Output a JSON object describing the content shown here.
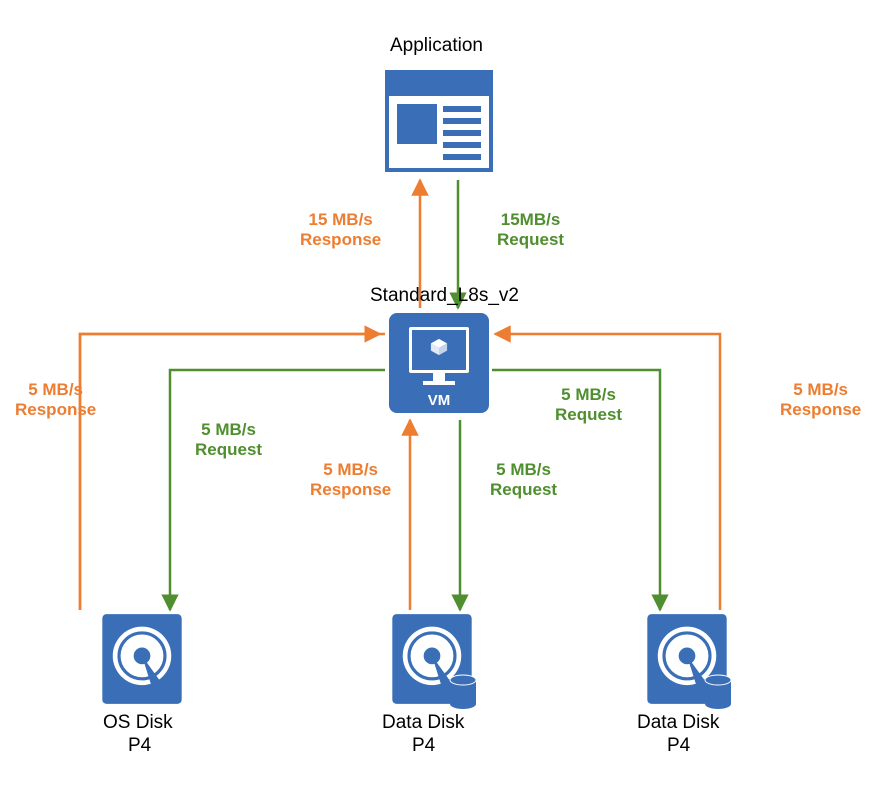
{
  "colors": {
    "blue": "#3a6fb7",
    "orange": "#ed7d31",
    "green": "#4f8f2f"
  },
  "top": {
    "title": "Application"
  },
  "app_vm": {
    "response": "15 MB/s\nResponse",
    "request": "15MB/s\nRequest"
  },
  "vm": {
    "title": "Standard_L8s_v2",
    "badge": "VM"
  },
  "flows": {
    "os_left": {
      "request": "5 MB/s\nRequest",
      "response": "5 MB/s\nResponse"
    },
    "data_mid": {
      "request": "5 MB/s\nRequest",
      "response": "5 MB/s\nResponse"
    },
    "data_right": {
      "request": "5 MB/s\nRequest",
      "response": "5 MB/s\nResponse"
    }
  },
  "disks": {
    "os": {
      "name": "OS Disk",
      "tier": "P4"
    },
    "data1": {
      "name": "Data Disk",
      "tier": "P4"
    },
    "data2": {
      "name": "Data Disk",
      "tier": "P4"
    }
  }
}
